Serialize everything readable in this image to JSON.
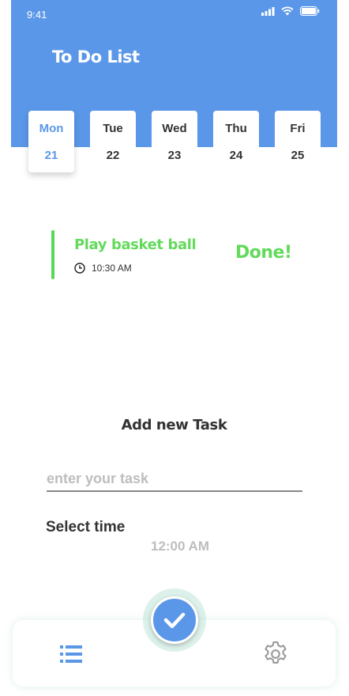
{
  "status_bar": {
    "time": "9:41"
  },
  "header": {
    "title": "To Do List"
  },
  "days": [
    {
      "name": "Mon",
      "date": "21",
      "active": true
    },
    {
      "name": "Tue",
      "date": "22",
      "active": false
    },
    {
      "name": "Wed",
      "date": "23",
      "active": false
    },
    {
      "name": "Thu",
      "date": "24",
      "active": false
    },
    {
      "name": "Fri",
      "date": "25",
      "active": false
    }
  ],
  "task": {
    "title": "Play basket ball",
    "time": "10:30 AM",
    "status": "Done!"
  },
  "add_task": {
    "title": "Add new Task",
    "input_placeholder": "enter your task",
    "input_value": "",
    "select_time_label": "Select time",
    "time_value": "12:00 AM"
  },
  "colors": {
    "accent": "#5b97e8",
    "done_green": "#63da5c"
  },
  "icons": {
    "nav_left": "list-icon",
    "nav_center": "check-icon",
    "nav_right": "gear-icon"
  }
}
